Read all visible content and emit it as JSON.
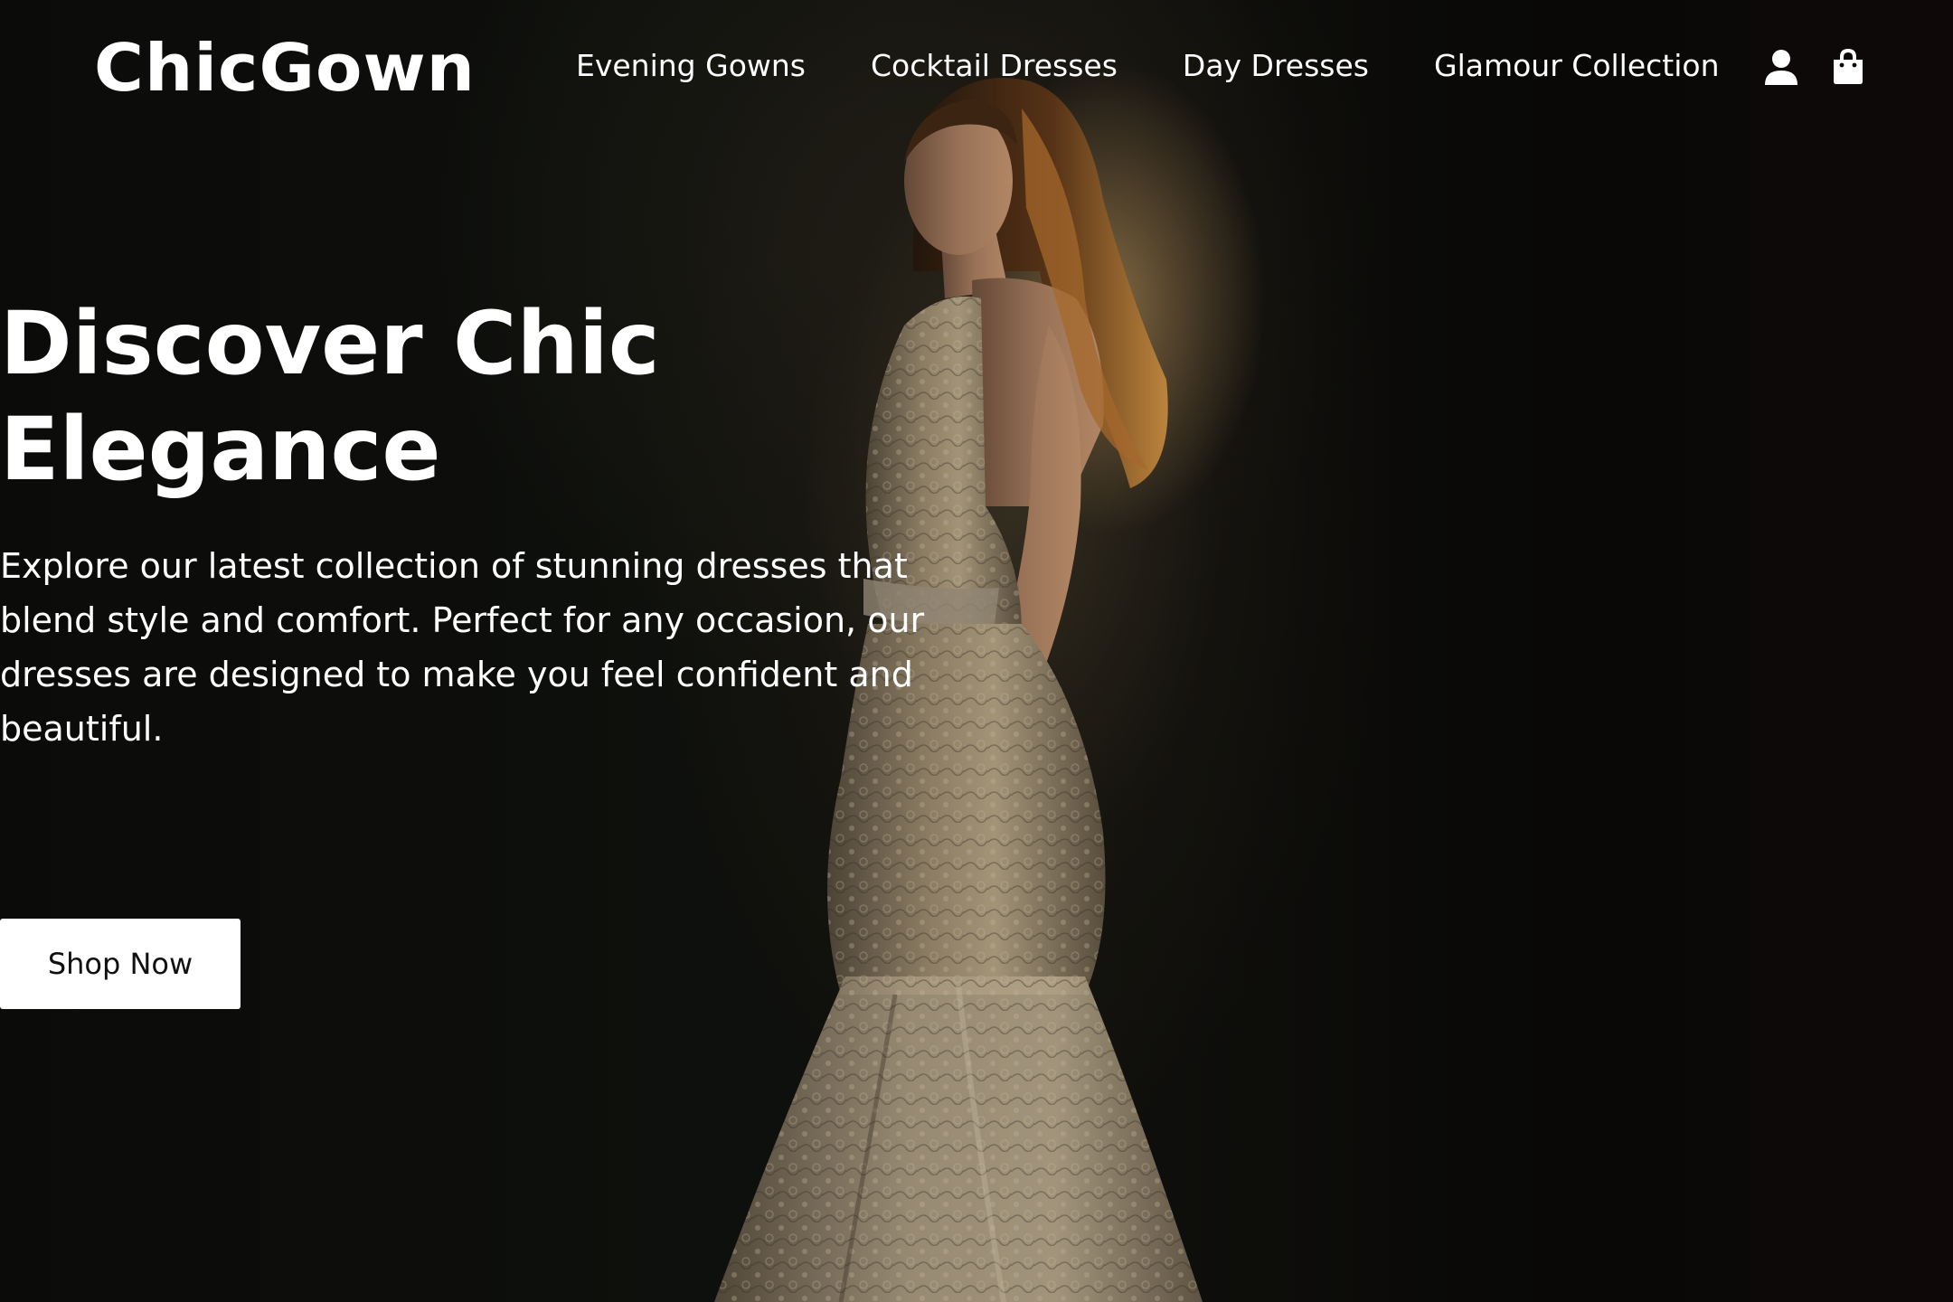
{
  "brand": {
    "logo_text": "ChicGown"
  },
  "nav": {
    "items": [
      {
        "label": "Evening Gowns"
      },
      {
        "label": "Cocktail Dresses"
      },
      {
        "label": "Day Dresses"
      },
      {
        "label": "Glamour Collection"
      }
    ]
  },
  "header_icons": {
    "account": "user-icon",
    "cart": "shopping-bag-icon"
  },
  "hero": {
    "title_lines": [
      "Discover Chic",
      "Elegance"
    ],
    "description_lines": [
      "Explore our latest collection of stunning dresses that",
      "blend style and comfort. Perfect for any occasion, our",
      "dresses are designed to make you feel confident and",
      "beautiful."
    ],
    "cta_label": "Shop Now",
    "background_image": "model-in-lace-gown-photo"
  },
  "colors": {
    "background": "#0b0b0a",
    "text": "#ffffff",
    "button_background": "#ffffff",
    "button_text": "#111111",
    "gown": "#b9a88a"
  }
}
